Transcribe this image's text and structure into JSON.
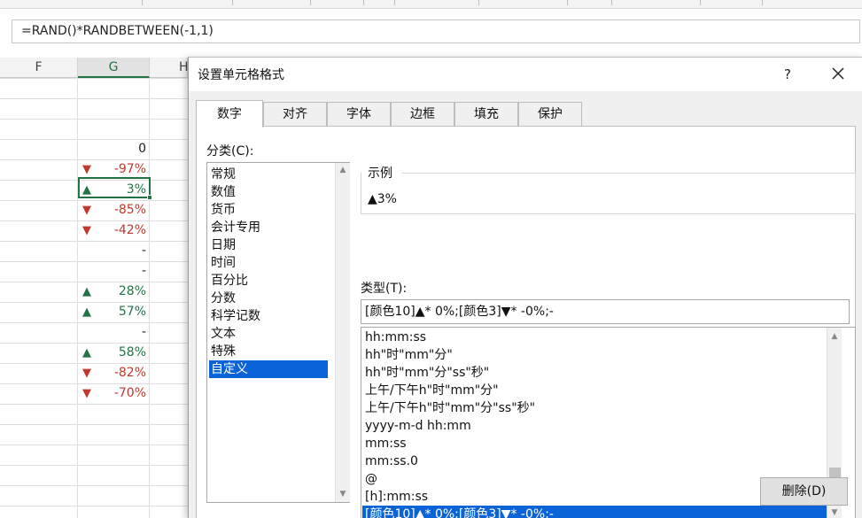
{
  "formula_bar": {
    "formula": "=RAND()*RANDBETWEEN(-1,1)"
  },
  "sheet": {
    "columns": [
      "F",
      "G",
      "H"
    ],
    "rows": [
      {
        "arrow": "",
        "value": "0",
        "tone": "black"
      },
      {
        "arrow": "▼",
        "value": "-97%",
        "tone": "red"
      },
      {
        "arrow": "▲",
        "value": "3%",
        "tone": "green"
      },
      {
        "arrow": "▼",
        "value": "-85%",
        "tone": "red"
      },
      {
        "arrow": "▼",
        "value": "-42%",
        "tone": "red"
      },
      {
        "arrow": "",
        "value": "-",
        "tone": "black"
      },
      {
        "arrow": "",
        "value": "-",
        "tone": "black"
      },
      {
        "arrow": "▲",
        "value": "28%",
        "tone": "green"
      },
      {
        "arrow": "▲",
        "value": "57%",
        "tone": "green"
      },
      {
        "arrow": "",
        "value": "-",
        "tone": "black"
      },
      {
        "arrow": "▲",
        "value": "58%",
        "tone": "green"
      },
      {
        "arrow": "▼",
        "value": "-82%",
        "tone": "red"
      },
      {
        "arrow": "▼",
        "value": "-70%",
        "tone": "red"
      }
    ]
  },
  "dialog": {
    "title": "设置单元格格式",
    "help": "?",
    "tabs": [
      "数字",
      "对齐",
      "字体",
      "边框",
      "填充",
      "保护"
    ],
    "active_tab": "数字",
    "category_label": "分类(C):",
    "categories": [
      "常规",
      "数值",
      "货币",
      "会计专用",
      "日期",
      "时间",
      "百分比",
      "分数",
      "科学记数",
      "文本",
      "特殊",
      "自定义"
    ],
    "selected_category": "自定义",
    "sample_label": "示例",
    "sample_value": "▲3%",
    "type_label": "类型(T):",
    "type_value": "[颜色10]▲* 0%;[颜色3]▼* -0%;-",
    "format_list": [
      "hh:mm:ss",
      "hh\"时\"mm\"分\"",
      "hh\"时\"mm\"分\"ss\"秒\"",
      "上午/下午h\"时\"mm\"分\"",
      "上午/下午h\"时\"mm\"分\"ss\"秒\"",
      "yyyy-m-d hh:mm",
      "mm:ss",
      "mm:ss.0",
      "@",
      "[h]:mm:ss",
      "[颜色10]▲* 0%;[颜色3]▼* -0%;-"
    ],
    "selected_format": "[颜色10]▲* 0%;[颜色3]▼* -0%;-",
    "delete_button": "删除(D)"
  },
  "colors": {
    "accent_green": "#217346",
    "negative_red": "#c0392b",
    "selection_blue": "#0a64d8"
  },
  "icons": {
    "close": "close-icon",
    "scroll_up": "scroll-up-arrow-icon",
    "scroll_down": "scroll-down-arrow-icon"
  }
}
